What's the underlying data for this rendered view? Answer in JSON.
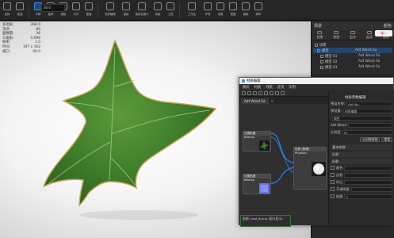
{
  "toolbar": {
    "items": [
      {
        "label": "选择",
        "icon": "select-icon"
      },
      {
        "label": "框选",
        "icon": "rect-select-icon"
      },
      {
        "label": "平移",
        "icon": "pan-icon"
      },
      {
        "label": "旋转",
        "icon": "rotate-icon"
      },
      {
        "label": "缩放",
        "icon": "scale-icon"
      },
      {
        "label": "对齐",
        "icon": "align-icon"
      },
      {
        "label": "重做",
        "icon": "redo-icon"
      },
      {
        "label": "材质编辑",
        "icon": "material-editor-icon"
      },
      {
        "label": "渲染",
        "icon": "render-icon"
      },
      {
        "label": "渲染帧窗口",
        "icon": "render-frame-icon"
      },
      {
        "label": "场景",
        "icon": "scene-icon"
      },
      {
        "label": "工具",
        "icon": "tools-icon"
      },
      {
        "label": "工作区",
        "icon": "workspace-icon"
      },
      {
        "label": "环境",
        "icon": "environment-icon"
      },
      {
        "label": "效果",
        "icon": "effects-icon"
      },
      {
        "label": "视图",
        "icon": "view-icon"
      },
      {
        "label": "模拟",
        "icon": "simulation-icon"
      },
      {
        "label": "脚本",
        "icon": "script-icon"
      }
    ],
    "coord_value": "30.0"
  },
  "stats": [
    {
      "label": "多边形:",
      "value": "368.0"
    },
    {
      "label": "顶点:",
      "value": "86"
    },
    {
      "label": "面数量:",
      "value": "36"
    },
    {
      "label": "三角形:",
      "value": "0.096"
    },
    {
      "label": "帧率:",
      "value": "1.0"
    },
    {
      "label": "时间:",
      "value": "197 x 162"
    },
    {
      "label": "视口:",
      "value": "90.0"
    }
  ],
  "right_panel": {
    "title": "场景",
    "header_right": "颜色",
    "tabs": [
      {
        "label": "创建",
        "icon": "create-icon"
      },
      {
        "label": "修改",
        "icon": "modify-icon"
      },
      {
        "label": "层次",
        "icon": "hierarchy-icon"
      },
      {
        "label": "运动",
        "icon": "motion-icon"
      },
      {
        "label": "显示",
        "icon": "display-icon"
      }
    ],
    "ime_text": "中 ·",
    "scene_rows": [
      {
        "name": "场景",
        "material": "",
        "selected": false
      },
      {
        "name": "模型",
        "material": "Adt Wood Sa",
        "selected": true
      },
      {
        "name": "模型 01",
        "material": "Adt Wood Sa",
        "selected": false
      },
      {
        "name": "模型 02",
        "material": "Adt Wood Sa",
        "selected": false
      },
      {
        "name": "模型 03",
        "material": "Adt Wood Sa",
        "selected": false
      }
    ]
  },
  "node_graph": {
    "window_title": "材质编辑",
    "menu": [
      "模式",
      "材质",
      "导航",
      "选项",
      "实用"
    ],
    "view_tab": "Adt Wood Sa",
    "tab_close": "×",
    "nodes": [
      {
        "title": "位图贴图",
        "subtitle": "Bitmap",
        "preview": "leaf"
      },
      {
        "title": "位图贴图",
        "subtitle": "Bitmap",
        "preview": "blue"
      },
      {
        "title": "材质 (物理)",
        "subtitle": "Physical",
        "preview": "sphere"
      }
    ],
    "tooltip_text": "贴图: Leaf_Bump (视口显示)",
    "side": {
      "title": "材质参数编辑",
      "rows": [
        {
          "label": "预设名称:",
          "value": "Adt Wo"
        },
        {
          "label": "预设值:",
          "value": "材质编辑"
        },
        {
          "label": "",
          "value": "颜色"
        },
        {
          "label": "Adt Wood",
          "value": ""
        },
        {
          "label": "反射度",
          "value": "50"
        }
      ],
      "buttons": [
        "从对象拾取",
        "重置"
      ],
      "sections": [
        "基本参数",
        "反射",
        "折射",
        "透明",
        "凹凸",
        "不透明度",
        "贴图"
      ],
      "bottom_rows": [
        {
          "label": "颜色",
          "value": ""
        },
        {
          "label": "反射",
          "value": ""
        },
        {
          "label": "凹凸",
          "value": ""
        },
        {
          "label": "不透明度",
          "value": ""
        },
        {
          "label": "贴图",
          "value": "0"
        }
      ]
    }
  }
}
